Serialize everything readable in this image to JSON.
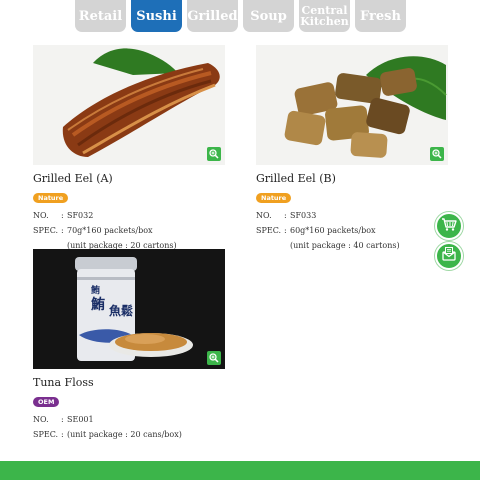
{
  "tabs": [
    {
      "label": "Retail",
      "active": false
    },
    {
      "label": "Sushi",
      "active": true
    },
    {
      "label": "Grilled",
      "active": false
    },
    {
      "label": "Soup",
      "active": false
    },
    {
      "label": "Central Kitchen",
      "active": false
    },
    {
      "label": "Fresh",
      "active": false
    }
  ],
  "products": [
    {
      "name": "Grilled Eel (A)",
      "badge": "Nature",
      "no_label": "NO.",
      "no_value": "SF032",
      "spec_label": "SPEC.",
      "spec_value": "70g*160 packets/box",
      "spec_extra": "(unit package : 20 cartons)"
    },
    {
      "name": "Grilled Eel (B)",
      "badge": "Nature",
      "no_label": "NO.",
      "no_value": "SF033",
      "spec_label": "SPEC.",
      "spec_value": "60g*160 packets/box",
      "spec_extra": "(unit package : 40 cartons)"
    },
    {
      "name": "Tuna Floss",
      "badge": "OEM",
      "no_label": "NO.",
      "no_value": "SE001",
      "spec_label": "SPEC.",
      "spec_value": "(unit package : 20 cans/box)"
    }
  ],
  "colors": {
    "accent_green": "#3cb54a",
    "tab_active": "#1e6fb8",
    "tab_inactive": "#d4d4d4",
    "badge_nature": "#f0a020",
    "badge_oem": "#7a2f8f"
  },
  "icons": {
    "zoom": "zoom-in-icon",
    "cart": "cart-icon",
    "mail": "mail-icon"
  }
}
